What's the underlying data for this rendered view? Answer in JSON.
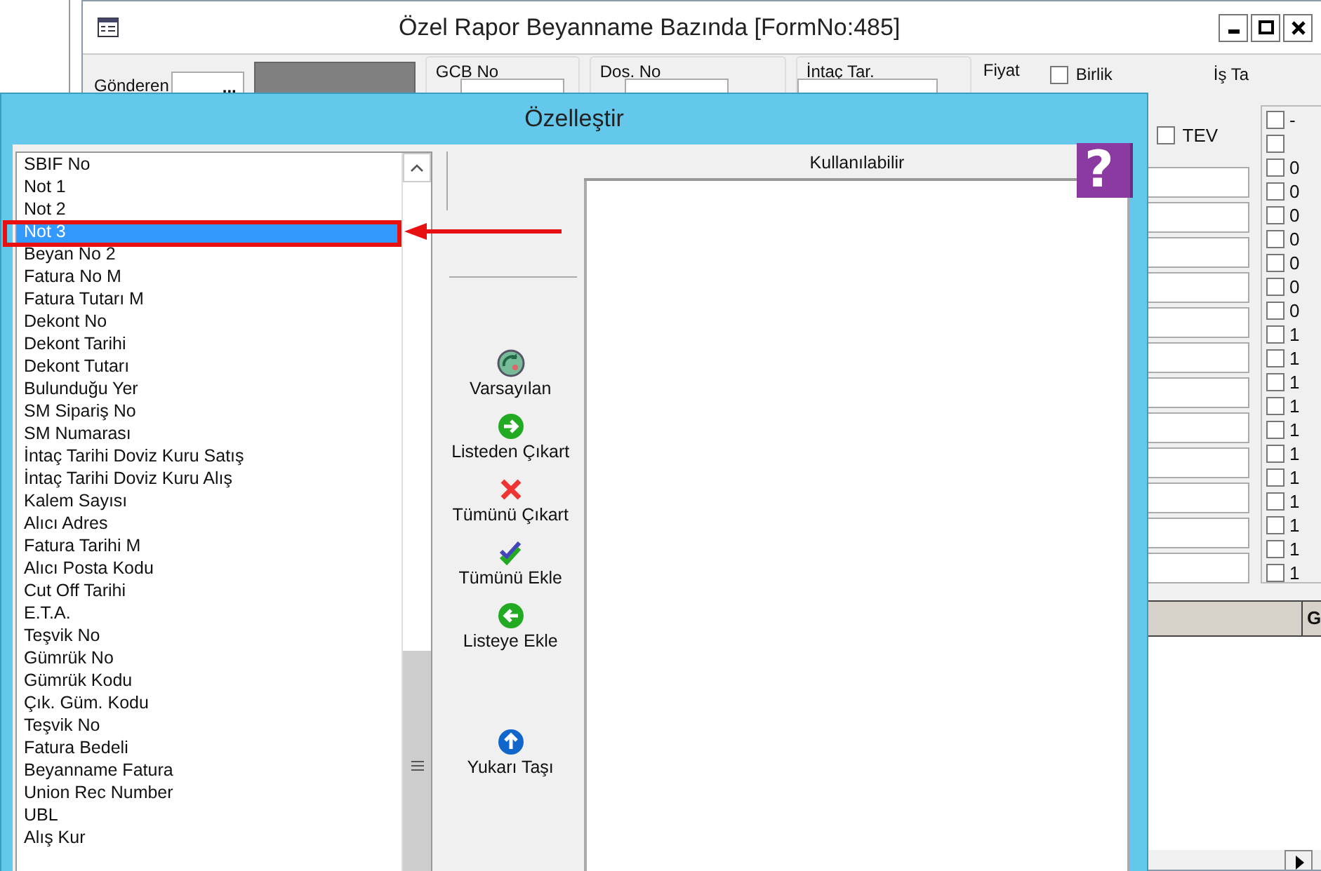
{
  "main_window": {
    "title": "Özel Rapor Beyanname Bazında [FormNo:485]",
    "filters": [
      {
        "kind": "picker",
        "label": "Gönderen",
        "button": "..."
      },
      {
        "kind": "group",
        "label": "GCB No"
      },
      {
        "kind": "group",
        "label": "Dos. No"
      },
      {
        "kind": "date",
        "label": "İntaç Tar."
      },
      {
        "kind": "text",
        "label": "Fiyat"
      },
      {
        "kind": "checkbox",
        "label": "Birlik",
        "checked": false
      },
      {
        "kind": "text",
        "label": "İş Ta"
      }
    ],
    "tev": {
      "label": "TEV",
      "checked": false
    },
    "checklist": [
      {
        "label": "-",
        "checked": false
      },
      {
        "checked": false
      },
      {
        "label": "0",
        "checked": false
      },
      {
        "label": "0",
        "checked": false
      },
      {
        "label": "0",
        "checked": false
      },
      {
        "label": "0",
        "checked": false
      },
      {
        "label": "0",
        "checked": false
      },
      {
        "label": "0",
        "checked": false
      },
      {
        "label": "0",
        "checked": false
      },
      {
        "label": "1",
        "checked": false
      },
      {
        "label": "1",
        "checked": false
      },
      {
        "label": "1",
        "checked": false
      },
      {
        "label": "1",
        "checked": false
      },
      {
        "label": "1",
        "checked": false
      },
      {
        "label": "1",
        "checked": false
      },
      {
        "label": "1",
        "checked": false
      },
      {
        "label": "1",
        "checked": false
      },
      {
        "label": "1",
        "checked": false
      },
      {
        "label": "1",
        "checked": false
      },
      {
        "label": "1",
        "checked": false
      }
    ],
    "grid": {
      "columns": [
        "G"
      ]
    }
  },
  "dialog": {
    "title": "Özelleştir",
    "selected_list": {
      "items": [
        {
          "label": "SBIF No",
          "selected": false
        },
        {
          "label": "Not 1",
          "selected": false
        },
        {
          "label": "Not 2",
          "selected": false
        },
        {
          "label": "Not 3",
          "selected": true
        },
        {
          "label": "Beyan No 2",
          "selected": false
        },
        {
          "label": "Fatura No M",
          "selected": false
        },
        {
          "label": "Fatura Tutarı M",
          "selected": false
        },
        {
          "label": "Dekont No",
          "selected": false
        },
        {
          "label": "Dekont Tarihi",
          "selected": false
        },
        {
          "label": "Dekont Tutarı",
          "selected": false
        },
        {
          "label": "Bulunduğu Yer",
          "selected": false
        },
        {
          "label": "SM Sipariş No",
          "selected": false
        },
        {
          "label": "SM Numarası",
          "selected": false
        },
        {
          "label": "İntaç Tarihi Doviz Kuru Satış",
          "selected": false
        },
        {
          "label": "İntaç Tarihi Doviz Kuru Alış",
          "selected": false
        },
        {
          "label": "Kalem Sayısı",
          "selected": false
        },
        {
          "label": "Alıcı Adres",
          "selected": false
        },
        {
          "label": "Fatura Tarihi M",
          "selected": false
        },
        {
          "label": "Alıcı Posta Kodu",
          "selected": false
        },
        {
          "label": "Cut Off Tarihi",
          "selected": false
        },
        {
          "label": "E.T.A.",
          "selected": false
        },
        {
          "label": "Teşvik No",
          "selected": false
        },
        {
          "label": "Gümrük No",
          "selected": false
        },
        {
          "label": "Gümrük Kodu",
          "selected": false
        },
        {
          "label": "Çık. Güm. Kodu",
          "selected": false
        },
        {
          "label": "Teşvik No",
          "selected": false
        },
        {
          "label": "Fatura Bedeli",
          "selected": false
        },
        {
          "label": "Beyanname Fatura",
          "selected": false
        },
        {
          "label": "Union Rec Number",
          "selected": false
        },
        {
          "label": "UBL",
          "selected": false
        },
        {
          "label": "Alış Kur",
          "selected": false
        }
      ]
    },
    "actions": [
      {
        "kind": "default",
        "label": "Varsayılan"
      },
      {
        "kind": "remove",
        "label": "Listeden Çıkart"
      },
      {
        "kind": "remove_all",
        "label": "Tümünü Çıkart"
      },
      {
        "kind": "add_all",
        "label": "Tümünü Ekle"
      },
      {
        "kind": "add",
        "label": "Listeye Ekle"
      },
      {
        "kind": "up",
        "label": "Yukarı Taşı"
      }
    ],
    "available_list": {
      "header": "Kullanılabilir"
    },
    "help_button": "?"
  }
}
